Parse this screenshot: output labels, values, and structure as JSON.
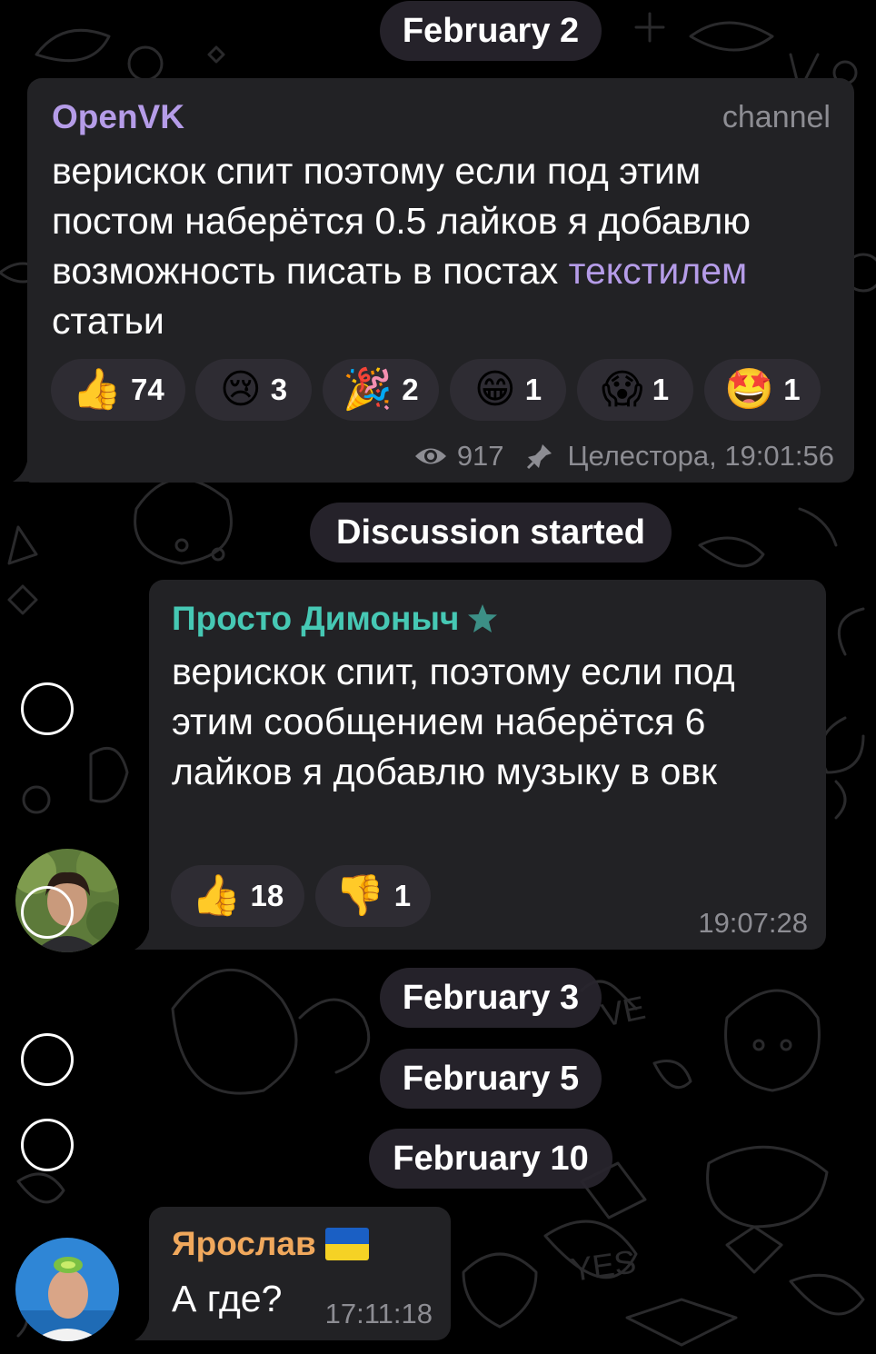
{
  "date_pills": [
    "February 2",
    "Discussion started",
    "February 3",
    "February 5",
    "February 10"
  ],
  "channel_post": {
    "name": "OpenVK",
    "badge": "channel",
    "text_before": "верискок спит поэтому если под этим постом наберётся 0.5 лайков я добавлю возможность писать в постах ",
    "text_highlight": "текстилем",
    "text_after": " статьи",
    "reactions": [
      {
        "emoji": "👍",
        "count": "74"
      },
      {
        "emoji": "😢",
        "count": "3"
      },
      {
        "emoji": "🎉",
        "count": "2"
      },
      {
        "emoji": "😁",
        "count": "1"
      },
      {
        "emoji": "😱",
        "count": "1"
      },
      {
        "emoji": "🤩",
        "count": "1"
      }
    ],
    "views": "917",
    "signature": "Целестора, 19:01:56",
    "icons": {
      "views": "eye-icon",
      "signature": "pin-icon"
    }
  },
  "comment": {
    "name": "Просто Димоныч",
    "name_color": "#46c8b4",
    "text": "верискок спит, поэтому если под этим сообщением наберётся 6 лайков я добавлю музыку в овк",
    "reactions": [
      {
        "emoji": "👍",
        "count": "18"
      },
      {
        "emoji": "👎",
        "count": "1"
      }
    ],
    "time": "19:07:28",
    "icon": "star-icon"
  },
  "reply": {
    "name": "Ярослав",
    "name_color": "#f0a85c",
    "text": "А где?",
    "time": "17:11:18",
    "icon": "ukraine-flag-icon"
  },
  "colors": {
    "background": "#000000",
    "bubble": "#222225",
    "accent_purple": "#b59ce8",
    "meta_gray": "#8d8d93"
  }
}
